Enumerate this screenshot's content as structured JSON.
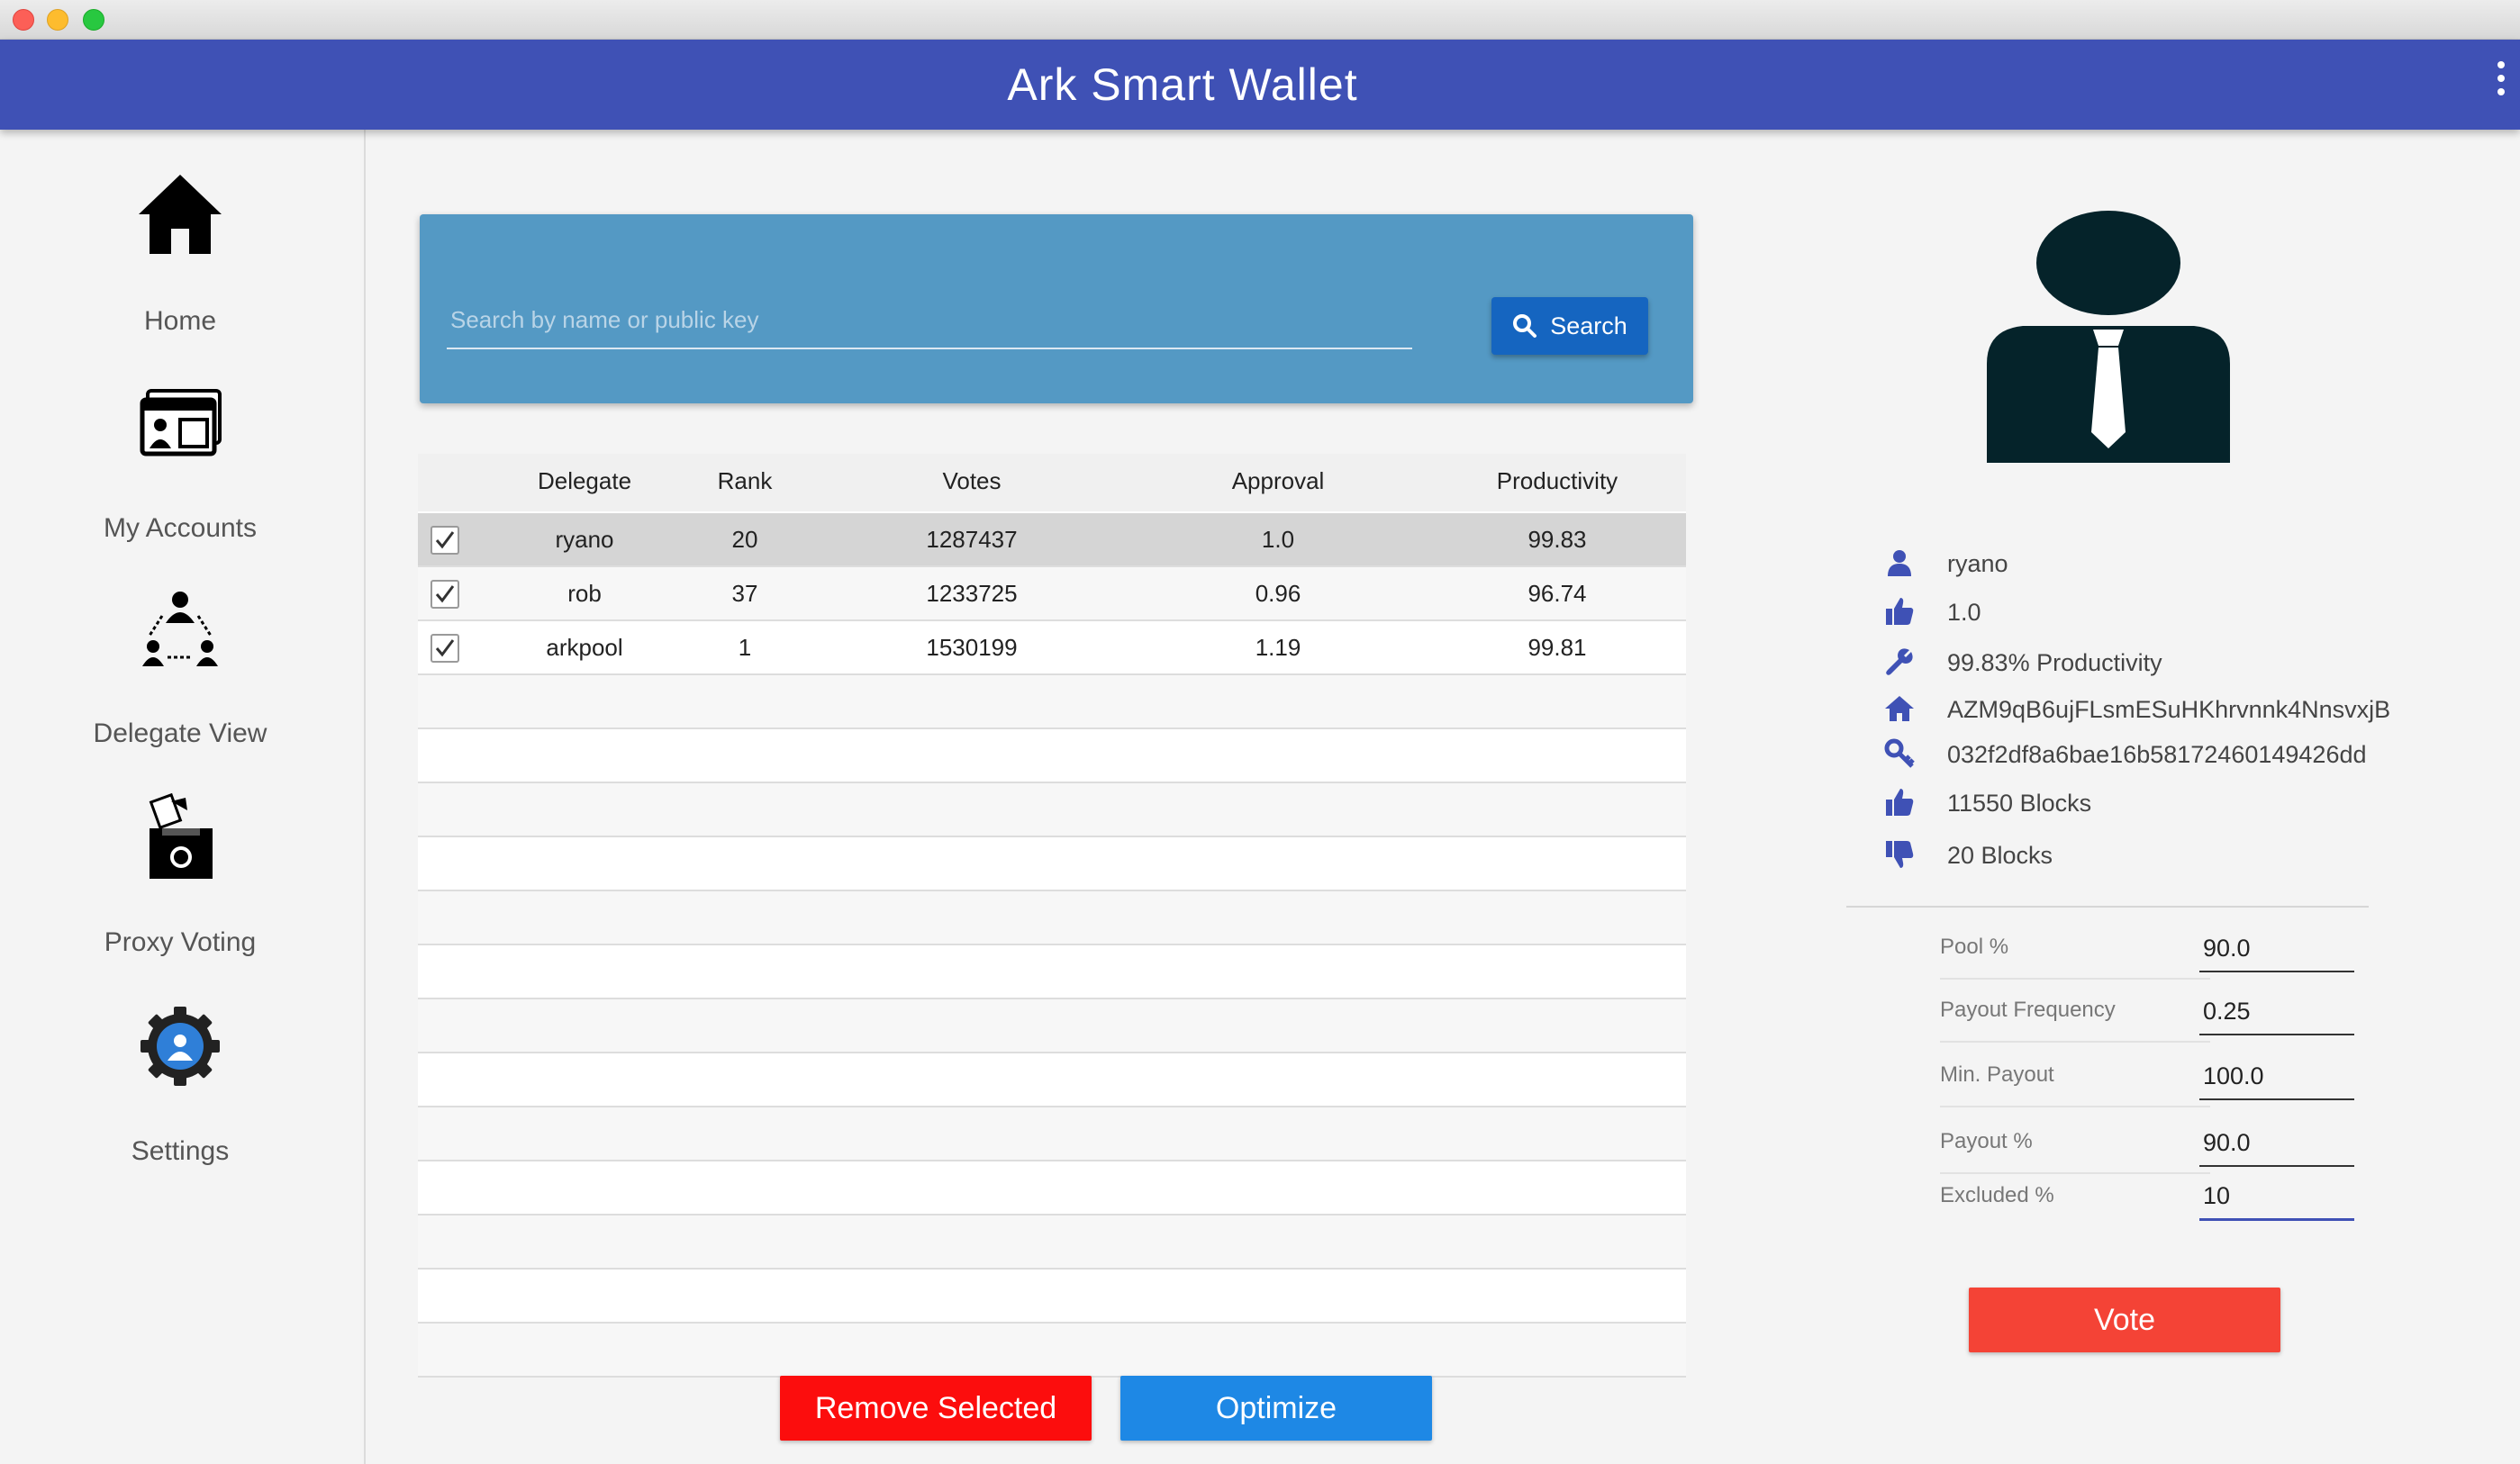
{
  "window": {
    "app_title": "Ark Smart Wallet"
  },
  "sidebar": {
    "items": [
      {
        "label": "Home",
        "icon": "home-icon"
      },
      {
        "label": "My Accounts",
        "icon": "accounts-icon"
      },
      {
        "label": "Delegate View",
        "icon": "delegate-network-icon"
      },
      {
        "label": "Proxy Voting",
        "icon": "ballot-box-icon"
      },
      {
        "label": "Settings",
        "icon": "settings-gear-icon"
      }
    ]
  },
  "search": {
    "placeholder": "Search by name or public key",
    "value": "",
    "button_label": "Search"
  },
  "table": {
    "headers": [
      "Delegate",
      "Rank",
      "Votes",
      "Approval",
      "Productivity"
    ],
    "rows": [
      {
        "checked": true,
        "delegate": "ryano",
        "rank": "20",
        "votes": "1287437",
        "approval": "1.0",
        "productivity": "99.83"
      },
      {
        "checked": true,
        "delegate": "rob",
        "rank": "37",
        "votes": "1233725",
        "approval": "0.96",
        "productivity": "96.74"
      },
      {
        "checked": true,
        "delegate": "arkpool",
        "rank": "1",
        "votes": "1530199",
        "approval": "1.19",
        "productivity": "99.81"
      }
    ]
  },
  "actions": {
    "remove_label": "Remove Selected",
    "optimize_label": "Optimize"
  },
  "details": {
    "name": "ryano",
    "approval": "1.0",
    "productivity": "99.83% Productivity",
    "address": "AZM9qB6ujFLsmESuHKhrvnnk4NnsvxjB",
    "public_key": "032f2df8a6bae16b58172460149426dd",
    "produced_blocks": "11550 Blocks",
    "missed_blocks": "20 Blocks"
  },
  "pool": {
    "fields": [
      {
        "label": "Pool %",
        "value": "90.0"
      },
      {
        "label": "Payout Frequency",
        "value": "0.25"
      },
      {
        "label": "Min. Payout",
        "value": "100.0"
      },
      {
        "label": "Payout %",
        "value": "90.0"
      },
      {
        "label": "Excluded %",
        "value": "10"
      }
    ],
    "vote_label": "Vote"
  },
  "colors": {
    "appbar": "#3f51b5",
    "search_panel": "#5499c4",
    "search_button": "#1565c0",
    "remove_button": "#fc0d0d",
    "optimize_button": "#1e88e5",
    "vote_button": "#f44336",
    "icon_accent": "#3f51b5"
  }
}
